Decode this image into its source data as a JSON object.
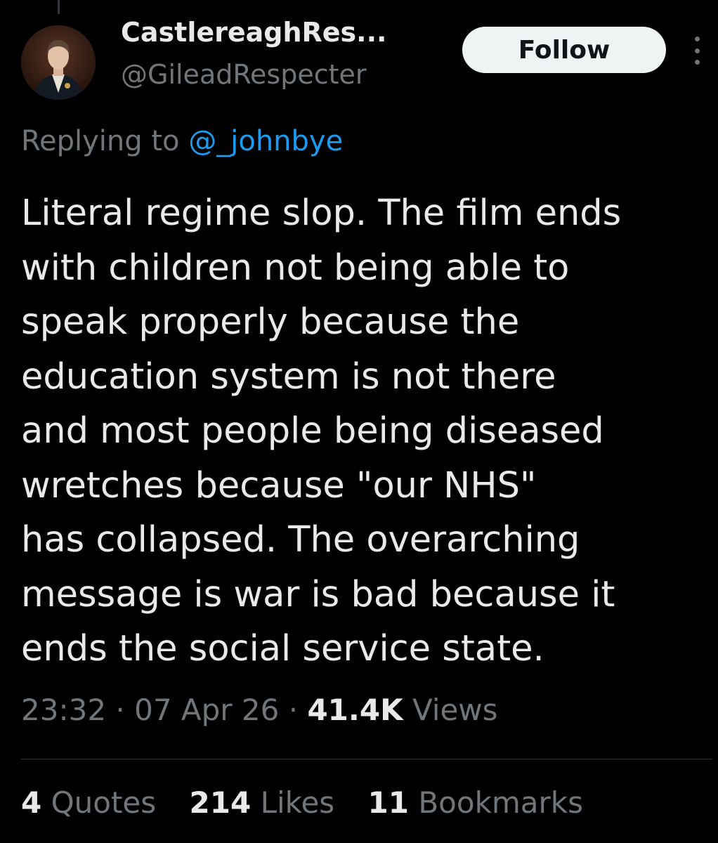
{
  "author": {
    "display_name": "CastlereaghRes...",
    "handle": "@GileadRespecter",
    "avatar_icon": "portrait-avatar"
  },
  "follow_button": {
    "label": "Follow"
  },
  "more_icon": "more-vertical-icon",
  "reply": {
    "prefix": "Replying to",
    "mention": "@_johnbye"
  },
  "tweet": {
    "lines": [
      "Literal regime slop. The film ends",
      "with children not being able to",
      "speak properly because the",
      "education system is not there",
      "and most people being diseased",
      "wretches because \"our NHS\"",
      "has collapsed. The overarching",
      "message is war is bad because it",
      "ends the social service state."
    ]
  },
  "meta": {
    "time": "23:32",
    "separator": "·",
    "date": "07 Apr 26",
    "views_count": "41.4K",
    "views_label": "Views"
  },
  "stats": [
    {
      "count": "4",
      "label": "Quotes"
    },
    {
      "count": "214",
      "label": "Likes"
    },
    {
      "count": "11",
      "label": "Bookmarks"
    }
  ],
  "colors": {
    "background": "#000000",
    "text_primary": "#e7e9ea",
    "text_secondary": "#71767b",
    "link": "#1d9bf0",
    "button_bg": "#eff3f4",
    "divider": "#2f3336"
  }
}
